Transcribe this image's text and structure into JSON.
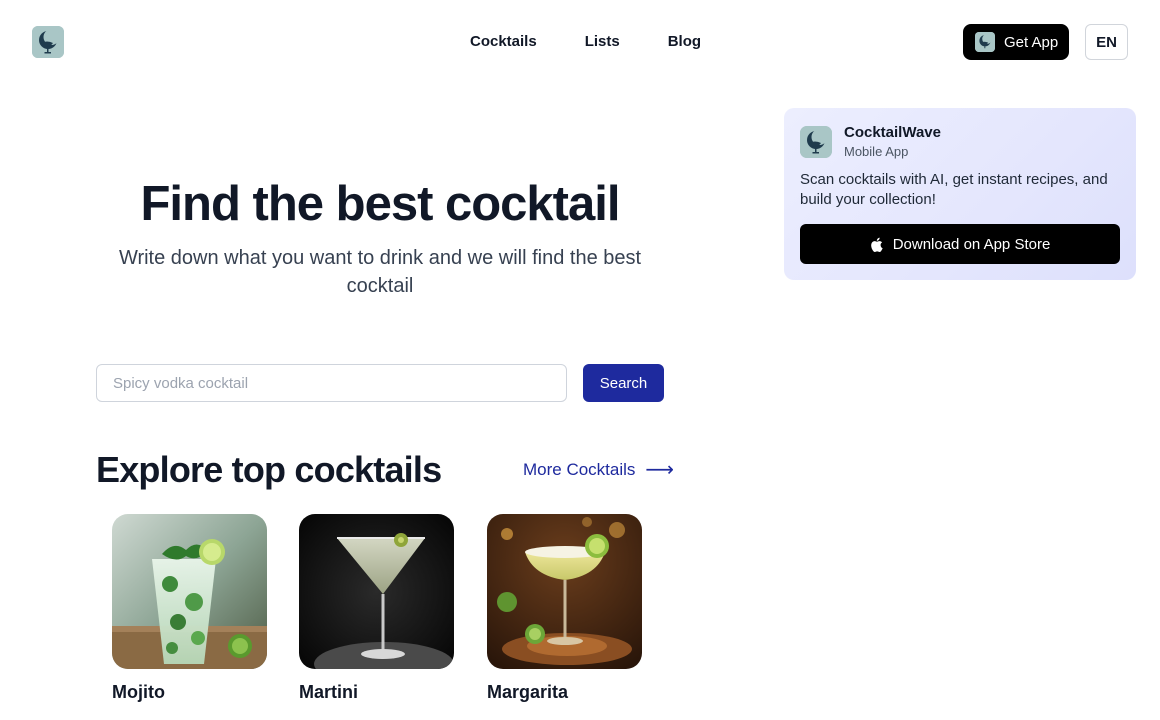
{
  "header": {
    "logo_icon": "crescent-bird-logo-icon",
    "nav": [
      {
        "label": "Cocktails"
      },
      {
        "label": "Lists"
      },
      {
        "label": "Blog"
      }
    ],
    "get_app_label": "Get App",
    "language": "EN"
  },
  "hero": {
    "title": "Find the best cocktail",
    "subtitle": "Write down what you want to drink and we will find the best cocktail"
  },
  "search": {
    "placeholder": "Spicy vodka cocktail",
    "value": "",
    "button_label": "Search"
  },
  "explore": {
    "title": "Explore top cocktails",
    "more_label": "More Cocktails",
    "more_icon": "arrow-right-icon",
    "cocktails": [
      {
        "name": "Mojito",
        "image": "mojito-photo"
      },
      {
        "name": "Martini",
        "image": "martini-photo"
      },
      {
        "name": "Margarita",
        "image": "margarita-photo"
      }
    ]
  },
  "promo": {
    "app_name": "CocktailWave",
    "app_type": "Mobile App",
    "description": "Scan cocktails with AI, get instant recipes, and build your collection!",
    "download_label": "Download on App Store",
    "download_icon": "apple-icon"
  },
  "colors": {
    "primary": "#1e2a9e",
    "text": "#111827",
    "promo_bg": "#e4e6fd",
    "logo_bg": "#a9c6c6"
  }
}
